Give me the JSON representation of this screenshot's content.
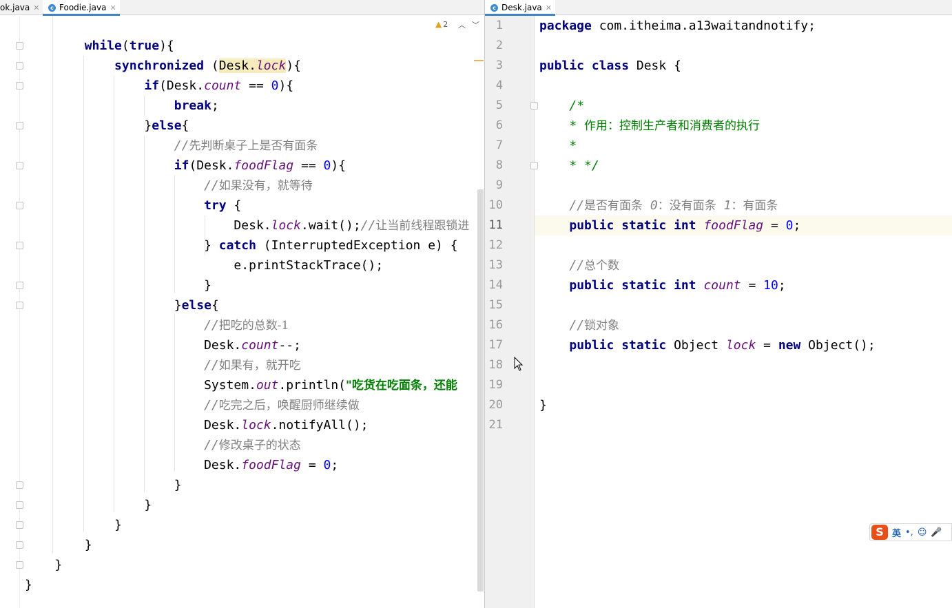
{
  "left_tabs": [
    {
      "label": "ok.java",
      "active": false
    },
    {
      "label": "Foodie.java",
      "active": true
    }
  ],
  "right_tabs": [
    {
      "label": "Desk.java",
      "active": true
    }
  ],
  "warning_count": "2",
  "foodie_code": [
    [
      "        ",
      {
        "k": "while"
      },
      "(",
      {
        "k": "true"
      },
      "){"
    ],
    [
      "            ",
      {
        "k": "synchronized"
      },
      " (",
      {
        "hl": "Desk."
      },
      {
        "hlf": "lock"
      },
      "){"
    ],
    [
      "                ",
      {
        "k": "if"
      },
      "(Desk.",
      {
        "f": "count"
      },
      " == ",
      {
        "n": "0"
      },
      "){"
    ],
    [
      "                    ",
      {
        "k": "break"
      },
      ";"
    ],
    [
      "                }",
      {
        "k": "else"
      },
      "{"
    ],
    [
      "                    ",
      {
        "c": "//"
      },
      {
        "cz": "先判断桌子上是否有面条"
      }
    ],
    [
      "                    ",
      {
        "k": "if"
      },
      "(Desk.",
      {
        "f": "foodFlag"
      },
      " == ",
      {
        "n": "0"
      },
      "){"
    ],
    [
      "                        ",
      {
        "c": "//"
      },
      {
        "cz": "如果没有，就等待"
      }
    ],
    [
      "                        ",
      {
        "k": "try"
      },
      " {"
    ],
    [
      "                            Desk.",
      {
        "f": "lock"
      },
      ".wait();",
      {
        "c": "//"
      },
      {
        "cz": "让当前线程跟锁进"
      }
    ],
    [
      "                        } ",
      {
        "k": "catch"
      },
      " (InterruptedException e) {"
    ],
    [
      "                            e.printStackTrace();"
    ],
    [
      "                        }"
    ],
    [
      "                    }",
      {
        "k": "else"
      },
      "{"
    ],
    [
      "                        ",
      {
        "c": "//"
      },
      {
        "cz": "把吃的总数-1"
      }
    ],
    [
      "                        Desk.",
      {
        "f": "count"
      },
      "--;"
    ],
    [
      "                        ",
      {
        "c": "//"
      },
      {
        "cz": "如果有，就开吃"
      }
    ],
    [
      "                        System.",
      {
        "f": "out"
      },
      ".println(",
      {
        "s": "\"吃货在吃面条，还能"
      }
    ],
    [
      "                        ",
      {
        "c": "//"
      },
      {
        "cz": "吃完之后，唤醒厨师继续做"
      }
    ],
    [
      "                        Desk.",
      {
        "f": "lock"
      },
      ".notifyAll();"
    ],
    [
      "                        ",
      {
        "c": "//"
      },
      {
        "cz": "修改桌子的状态"
      }
    ],
    [
      "                        Desk.",
      {
        "f": "foodFlag"
      },
      " = ",
      {
        "n": "0"
      },
      ";"
    ],
    [
      "                    }"
    ],
    [
      "                }"
    ],
    [
      "            }"
    ],
    [
      "        }"
    ],
    [
      "    }"
    ],
    [
      "}"
    ]
  ],
  "desk_line_numbers": [
    "1",
    "2",
    "3",
    "4",
    "5",
    "6",
    "7",
    "8",
    "9",
    "10",
    "11",
    "12",
    "13",
    "14",
    "15",
    "16",
    "17",
    "18",
    "19",
    "20",
    "21"
  ],
  "desk_code": [
    [
      {
        "k": "package"
      },
      " com.itheima.a13waitandnotify;"
    ],
    [
      ""
    ],
    [
      {
        "k": "public class"
      },
      " Desk {"
    ],
    [
      ""
    ],
    [
      "    ",
      {
        "g": "/*"
      }
    ],
    [
      "    ",
      {
        "g": "* "
      },
      {
        "gz": "作用：控制生产者和消费者的执行"
      }
    ],
    [
      "    ",
      {
        "g": "*"
      }
    ],
    [
      "    ",
      {
        "g": "* */"
      }
    ],
    [
      ""
    ],
    [
      "    ",
      {
        "c": "//"
      },
      {
        "cz": "是否有面条  "
      },
      {
        "c": "0"
      },
      {
        "cz": "：没有面条  "
      },
      {
        "c": "1"
      },
      {
        "cz": "：有面条"
      }
    ],
    [
      "    ",
      {
        "k": "public static int"
      },
      " ",
      {
        "f": "foodFlag"
      },
      " = ",
      {
        "n": "0"
      },
      ";"
    ],
    [
      ""
    ],
    [
      "    ",
      {
        "c": "//"
      },
      {
        "cz": "总个数"
      }
    ],
    [
      "    ",
      {
        "k": "public static int"
      },
      " ",
      {
        "f": "count"
      },
      " = ",
      {
        "n": "10"
      },
      ";"
    ],
    [
      ""
    ],
    [
      "    ",
      {
        "c": "//"
      },
      {
        "cz": "锁对象"
      }
    ],
    [
      "    ",
      {
        "k": "public static"
      },
      " Object ",
      {
        "f": "lock"
      },
      " = ",
      {
        "k": "new"
      },
      " Object();"
    ],
    [
      ""
    ],
    [
      ""
    ],
    [
      "}"
    ],
    [
      ""
    ]
  ],
  "current_line": "11",
  "ime": {
    "lang": "英",
    "punct": "•,",
    "emoji": "☺",
    "mic": "🎤",
    "logo": "S"
  },
  "colors": {
    "keyword": "#000080",
    "field": "#660e7a",
    "number": "#0000ff",
    "comment": "#808080",
    "doc_comment": "#008000",
    "tab_accent": "#4083c9"
  }
}
